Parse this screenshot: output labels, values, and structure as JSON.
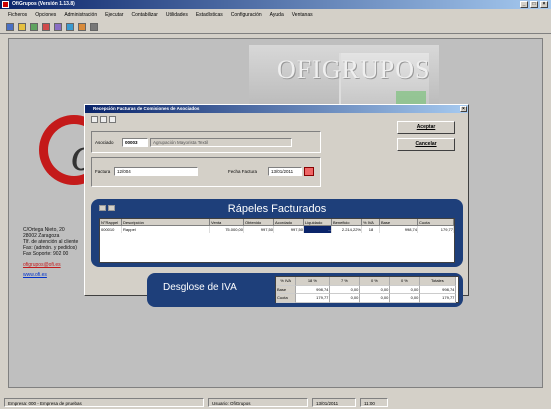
{
  "window": {
    "title": "OfiGrupos (Versión 1.13.8)",
    "controls": [
      "_",
      "□",
      "×"
    ]
  },
  "menu": [
    "Ficheros",
    "Opciones",
    "Administración",
    "Ejecutar",
    "Contabilizar",
    "Utilidades",
    "Estadísticas",
    "Configuración",
    "Ayuda",
    "Ventanas"
  ],
  "banner": {
    "text": "OFIGRUPOS"
  },
  "company": {
    "lines": [
      "C/Ortega Nieto, 20",
      "28002 Zaragoza",
      "Tlf. de atención al cliente",
      "Fax: (admón. y pedidos)",
      "Fax Soporte: 902 00"
    ],
    "email": "ofigrupos@ofi.es",
    "web": "www.ofi.es"
  },
  "dialog": {
    "title": "Recepción Facturas de Comisiones de Asociados",
    "asociado_label": "Asociado",
    "asociado_code": "00003",
    "asociado_name": "Agrupación Mayorista Textil",
    "factura_label": "Factura",
    "factura_value": "12/004",
    "fecha_label": "Fecha Factura",
    "fecha_value": "13/01/2011",
    "aceptar": "Aceptar",
    "cancelar": "Cancelar"
  },
  "rappeles": {
    "title": "Rápeles Facturados",
    "headers": [
      "N°Rappel",
      "Descripción",
      "Venta",
      "Obtenido",
      "Acordado",
      "Liquidado",
      "Beneficio",
      "% IVA",
      "Base",
      "Cuota"
    ],
    "rows": [
      [
        "000010",
        "Rappel",
        "75.000,00",
        "997,50",
        "997,50",
        "...",
        "2.214,22%",
        "18",
        "998,74",
        "179,77"
      ]
    ]
  },
  "iva": {
    "title": "Desglose de IVA",
    "headers": [
      "% IVA",
      "18 %",
      "7 %",
      "0 %",
      "0 %",
      "Totales"
    ],
    "rows": [
      [
        "Base",
        "998,74",
        "0,00",
        "0,00",
        "0,00",
        "998,74"
      ],
      [
        "Cuota",
        "179,77",
        "0,00",
        "0,00",
        "0,00",
        "179,77"
      ]
    ]
  },
  "status": {
    "left": "Empresa: 000 - Empresa de pruebas",
    "mid": "Usuario: OfiGrupos",
    "date": "13/01/2011",
    "time": "11:00"
  }
}
